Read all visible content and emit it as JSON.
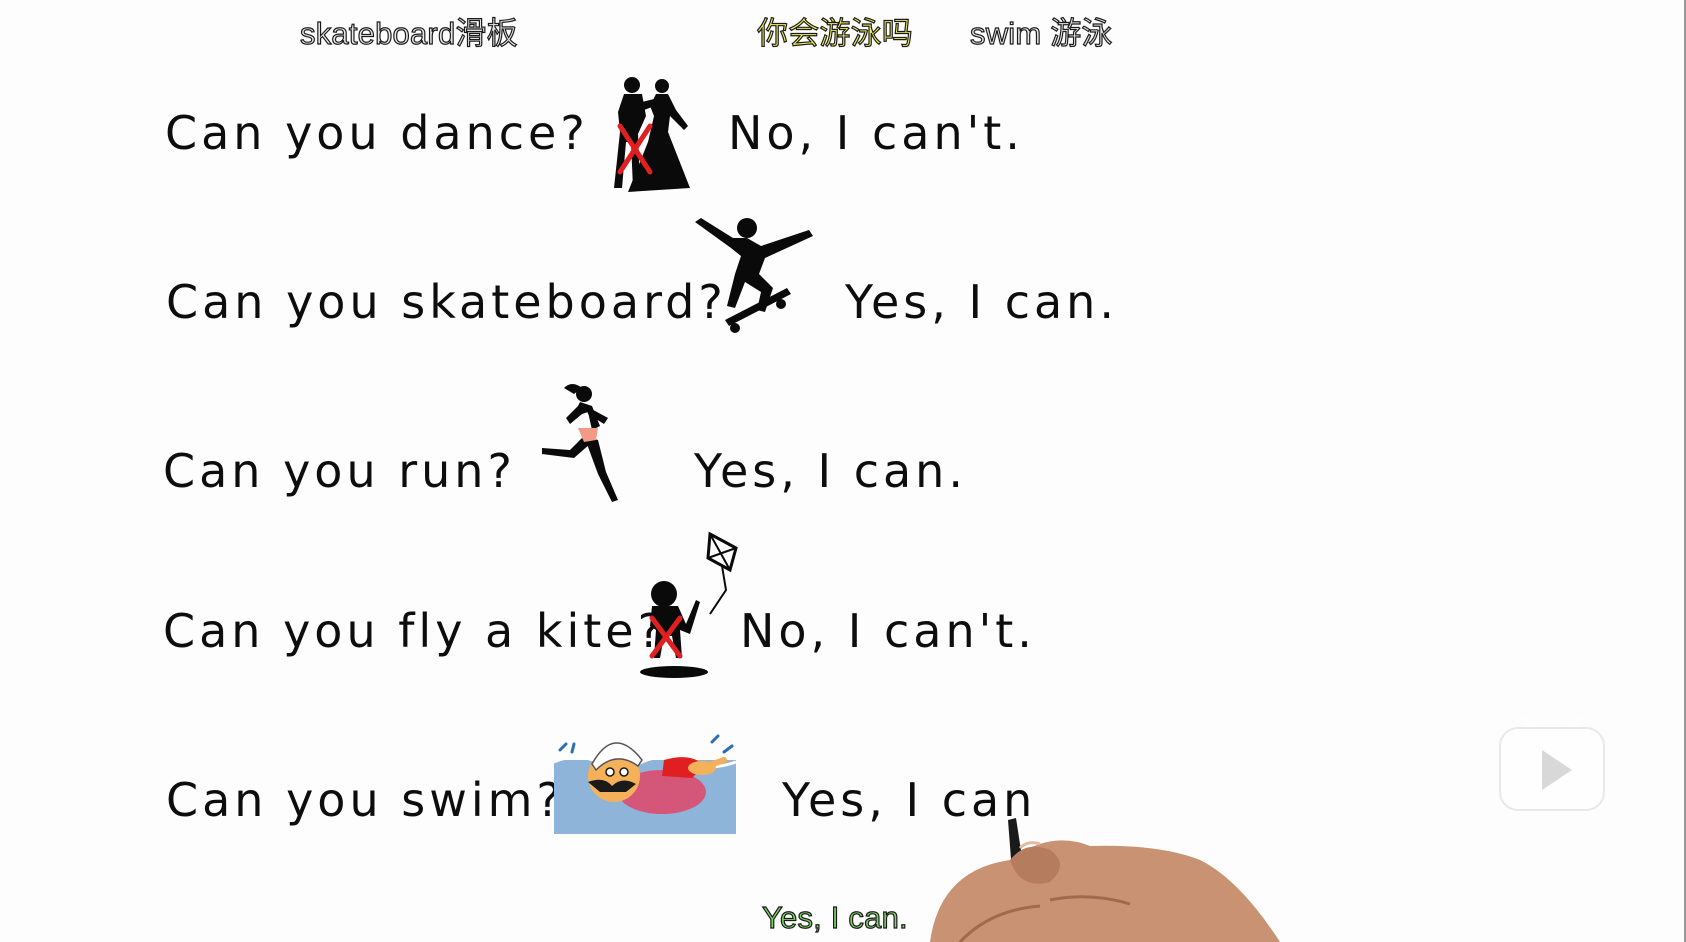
{
  "subtitles": {
    "top_left": "skateboard滑板",
    "top_center": "你会游泳吗",
    "top_right": "swim 游泳",
    "bottom": "Yes, I can."
  },
  "rows": [
    {
      "question": "Can you dance?",
      "answer": "No, I can't.",
      "icon": "dancing-couple-icon",
      "crossed": true
    },
    {
      "question": "Can you skateboard?",
      "answer": "Yes, I can.",
      "icon": "skateboarder-icon",
      "crossed": false
    },
    {
      "question": "Can you run?",
      "answer": "Yes, I can.",
      "icon": "runner-icon",
      "crossed": false
    },
    {
      "question": "Can you fly a kite?",
      "answer": "No, I can't.",
      "icon": "kite-flyer-icon",
      "crossed": true
    },
    {
      "question": "Can you swim?",
      "answer": "Yes, I can",
      "icon": "swimmer-icon",
      "crossed": false
    }
  ],
  "overlay": {
    "play_icon": "play-icon",
    "hand_icon": "drawing-hand-icon"
  },
  "colors": {
    "background": "#fdfdfd",
    "text": "#0d0d0d",
    "cross": "#e02020",
    "subtitle_yellow": "#f2ef5a",
    "subtitle_green": "#7fd36a",
    "water": "#8fb4d9"
  }
}
